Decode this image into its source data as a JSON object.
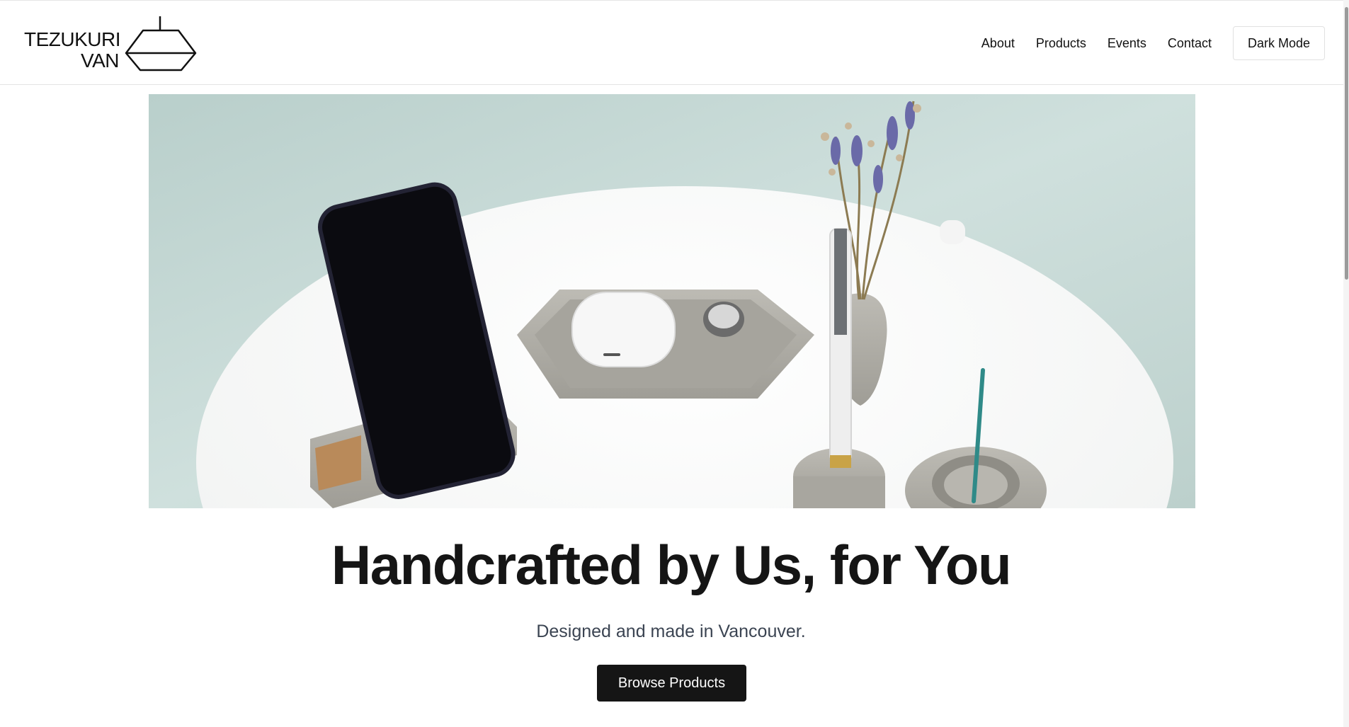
{
  "brand": {
    "line1": "TEZUKURI",
    "line2": "VAN",
    "logo_icon": "pendant-lamp-icon"
  },
  "nav": {
    "items": [
      {
        "label": "About"
      },
      {
        "label": "Products"
      },
      {
        "label": "Events"
      },
      {
        "label": "Contact"
      }
    ],
    "dark_mode_label": "Dark Mode"
  },
  "hero": {
    "image": "photo of a white round table with concrete phone stand holding a black smartphone, hexagonal concrete tray with earbuds case and a ring, a pen in a concrete holder, a concrete vase with dried lavender, and a concrete incense holder with a teal incense stick",
    "headline": "Handcrafted by Us, for You",
    "subheadline": "Designed and made in Vancouver.",
    "cta_label": "Browse Products"
  },
  "colors": {
    "text": "#151515",
    "subtext": "#3b4452",
    "button_bg": "#151515",
    "button_text": "#ffffff",
    "hero_background": "#c6d8d4"
  }
}
